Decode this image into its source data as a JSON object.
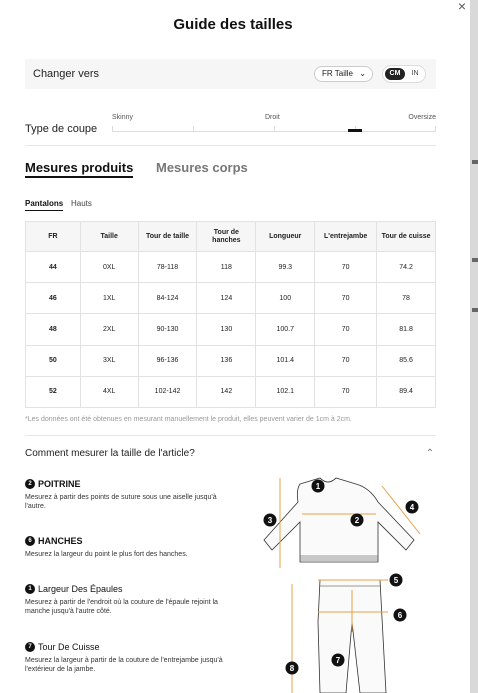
{
  "modal": {
    "title": "Guide des tailles",
    "close_glyph": "×"
  },
  "convert": {
    "label": "Changer vers",
    "region_selected": "FR Taille",
    "units": {
      "cm": "CM",
      "in": "IN",
      "active": "CM"
    }
  },
  "fit": {
    "label": "Type de coupe",
    "scale": [
      "Skinny",
      "Droit",
      "Oversize"
    ],
    "level_percent": 75
  },
  "tabs": {
    "products": "Mesures produits",
    "body": "Mesures corps",
    "active": "products"
  },
  "subtabs": {
    "pants": "Pantalons",
    "tops": "Hauts",
    "active": "pants"
  },
  "table": {
    "headers": [
      "FR",
      "Taille",
      "Tour de taille",
      "Tour de hanches",
      "Longueur",
      "L'entrejambe",
      "Tour de cuisse"
    ],
    "rows": [
      [
        "44",
        "0XL",
        "78-118",
        "118",
        "99.3",
        "70",
        "74.2"
      ],
      [
        "46",
        "1XL",
        "84-124",
        "124",
        "100",
        "70",
        "78"
      ],
      [
        "48",
        "2XL",
        "90-130",
        "130",
        "100.7",
        "70",
        "81.8"
      ],
      [
        "50",
        "3XL",
        "96-136",
        "136",
        "101.4",
        "70",
        "85.6"
      ],
      [
        "52",
        "4XL",
        "102-142",
        "142",
        "102.1",
        "70",
        "89.4"
      ]
    ]
  },
  "note": "*Les données ont été obtenues en mesurant manuellement le produit, elles peuvent varier de 1cm à 2cm.",
  "howto": {
    "title": "Comment mesurer la taille de l'article?"
  },
  "measures": [
    {
      "num": "2",
      "name": "POITRINE",
      "desc": "Mesurez à partir des points de suture sous une aiselle jusqu'à l'autre."
    },
    {
      "num": "6",
      "name": "HANCHES",
      "desc": "Mesurez la largeur du point le plus fort des hanches."
    },
    {
      "num": "1",
      "name": "Largeur Des Épaules",
      "desc": "Mesurez à partir de l'endroit où la couture de l'épaule rejoint la manche jusqu'à l'autre côté."
    },
    {
      "num": "7",
      "name": "Tour De Cuisse",
      "desc": "Mesurez la largeur à partir de la couture de l'entrejambe jusqu'à l'extérieur de la jambe."
    }
  ],
  "diagram_labels": [
    "1",
    "2",
    "3",
    "4",
    "5",
    "6",
    "7",
    "8"
  ],
  "colors": {
    "accent": "#111111",
    "measure_line": "#e8a24a"
  }
}
